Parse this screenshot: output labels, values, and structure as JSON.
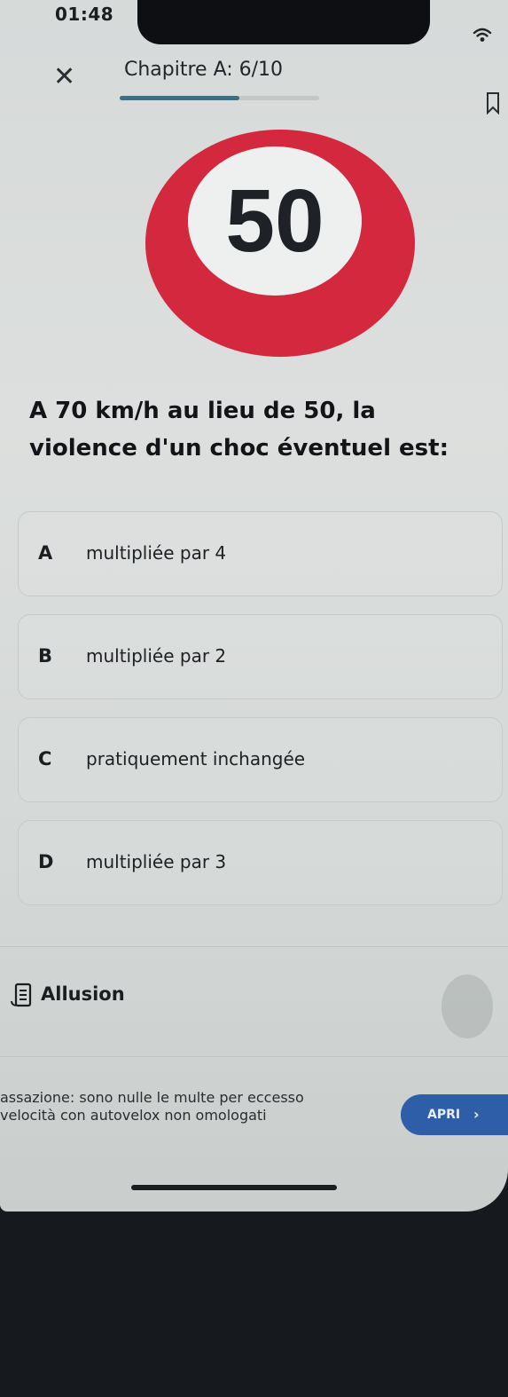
{
  "status_bar": {
    "time": "01:48"
  },
  "header": {
    "close_icon": "close-icon",
    "chapter_label": "Chapitre A: 6/10",
    "progress": 0.6,
    "progress_color": "#3b6f84"
  },
  "sign": {
    "number": "50",
    "ring_color": "#d4283e"
  },
  "question": {
    "text": "A 70 km/h au lieu de 50, la violence d'un choc éventuel est:"
  },
  "options": [
    {
      "letter": "A",
      "text": "multipliée par 4"
    },
    {
      "letter": "B",
      "text": "multipliée par 2"
    },
    {
      "letter": "C",
      "text": "pratiquement inchangée"
    },
    {
      "letter": "D",
      "text": "multipliée par 3"
    }
  ],
  "hint": {
    "label": "Allusion",
    "icon": "book-icon"
  },
  "ad": {
    "line1": "assazione: sono nulle le multe per eccesso",
    "line2": "velocità con autovelox non omologati",
    "button_label": "APRI",
    "button_color": "#2f5ea8"
  }
}
